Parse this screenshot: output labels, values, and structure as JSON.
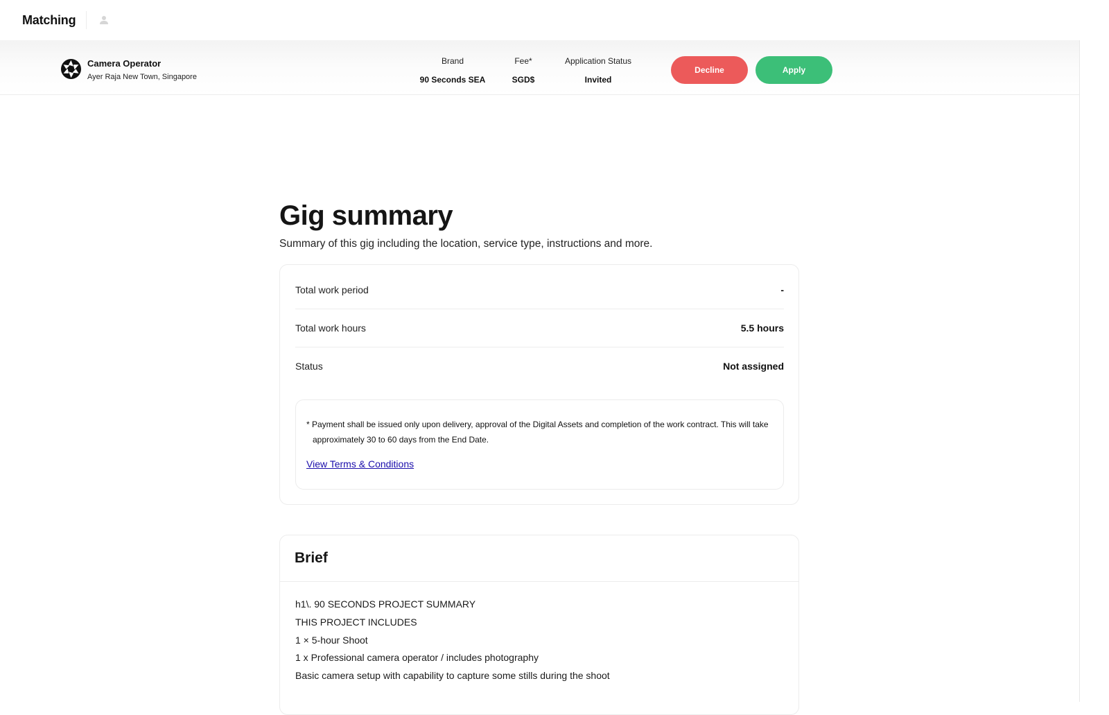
{
  "app": {
    "title": "Matching"
  },
  "gig": {
    "role": "Camera Operator",
    "location": "Ayer Raja New Town, Singapore",
    "brand_label": "Brand",
    "brand_value": "90 Seconds SEA",
    "fee_label": "Fee*",
    "fee_value": "SGD$",
    "application_status_label": "Application Status",
    "application_status_value": "Invited",
    "decline_label": "Decline",
    "apply_label": "Apply"
  },
  "summary": {
    "title": "Gig summary",
    "subtitle": "Summary of this gig including the location, service type, instructions and more.",
    "rows": [
      {
        "label": "Total work period",
        "value": "-"
      },
      {
        "label": "Total work hours",
        "value": "5.5 hours"
      },
      {
        "label": "Status",
        "value": "Not assigned"
      }
    ],
    "payment_note": "* Payment shall be issued only upon delivery, approval of the Digital Assets and completion of the work contract. This will take approximately 30 to 60 days from the End Date.",
    "terms_link": "View Terms & Conditions"
  },
  "brief": {
    "title": "Brief",
    "lines": [
      "h1\\. 90 SECONDS PROJECT SUMMARY",
      "THIS PROJECT INCLUDES",
      "1 × 5-hour Shoot",
      "1 x Professional camera operator / includes photography",
      "Basic camera setup with capability to capture some stills during the shoot"
    ]
  },
  "colors": {
    "decline": "#ec5a5a",
    "apply": "#3cbf78",
    "link": "#1a0dab"
  },
  "icons": {
    "user": "user-icon",
    "brand_logo": "camera-aperture-icon"
  }
}
